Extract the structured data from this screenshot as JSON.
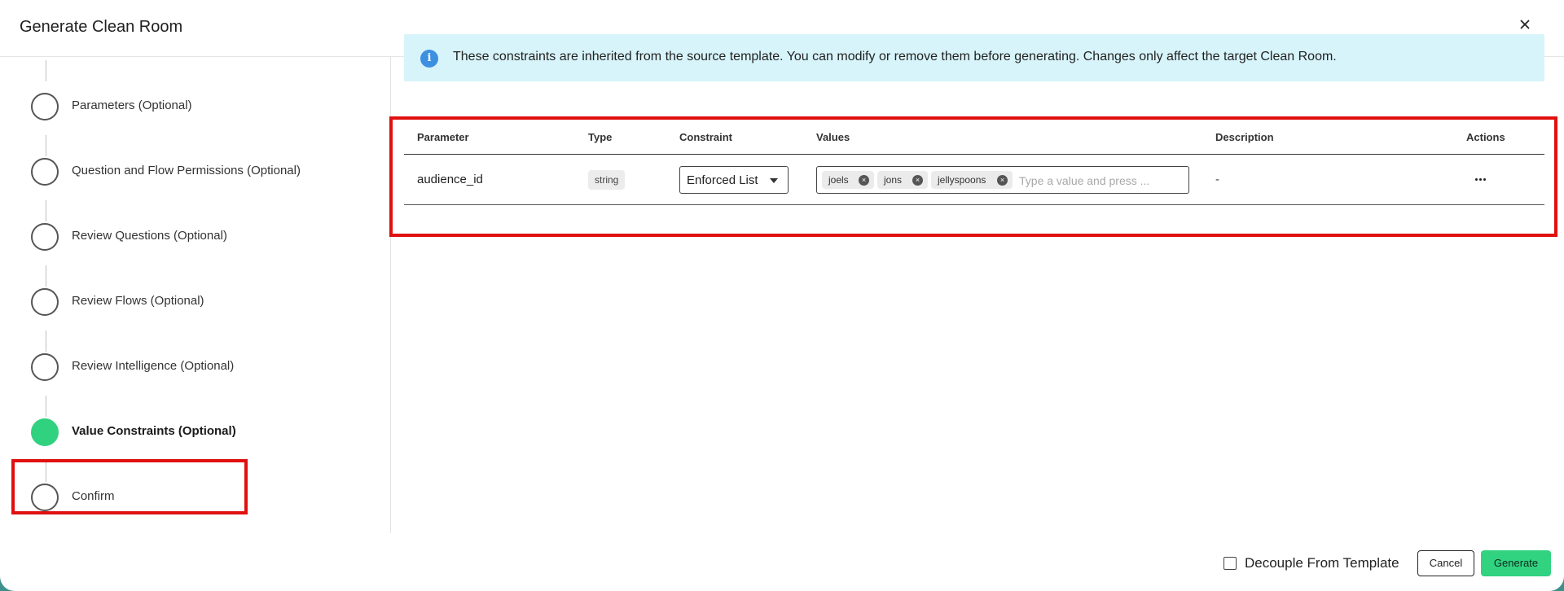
{
  "dialog": {
    "title": "Generate Clean Room",
    "close_icon": "close-icon"
  },
  "steps": [
    {
      "label": "Parameters (Optional)",
      "active": false
    },
    {
      "label": "Question and Flow Permissions (Optional)",
      "active": false
    },
    {
      "label": "Review Questions (Optional)",
      "active": false
    },
    {
      "label": "Review Flows (Optional)",
      "active": false
    },
    {
      "label": "Review Intelligence (Optional)",
      "active": false
    },
    {
      "label": "Value Constraints (Optional)",
      "active": true
    },
    {
      "label": "Confirm",
      "active": false
    }
  ],
  "info": {
    "icon": "info-icon",
    "text": "These constraints are inherited from the source template. You can modify or remove them before generating. Changes only affect the target Clean Room."
  },
  "table": {
    "headers": {
      "parameter": "Parameter",
      "type": "Type",
      "constraint": "Constraint",
      "values": "Values",
      "description": "Description",
      "actions": "Actions"
    },
    "rows": [
      {
        "parameter": "audience_id",
        "type": "string",
        "constraint": "Enforced List",
        "values": [
          "joels",
          "jons",
          "jellyspoons"
        ],
        "values_placeholder": "Type a value and press ...",
        "description": "-"
      }
    ]
  },
  "footer": {
    "decouple_label": "Decouple From Template",
    "decouple_checked": false,
    "cancel_label": "Cancel",
    "generate_label": "Generate"
  },
  "colors": {
    "accent": "#31d280",
    "highlight": "#e01010",
    "info_bg": "#d7f4fa",
    "info_icon": "#3d8fe0"
  }
}
